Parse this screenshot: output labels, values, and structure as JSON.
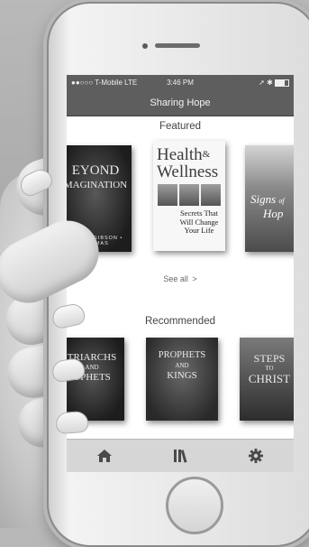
{
  "statusbar": {
    "carrier": "●●○○○ T-Mobile  LTE",
    "time": "3:46 PM",
    "icons": "➚ ✱"
  },
  "navbar": {
    "title": "Sharing Hope"
  },
  "featured": {
    "title": "Featured",
    "see_all": "See all",
    "see_all_chevron": ">",
    "books": [
      {
        "title_lines": [
          "EYOND",
          "MAGINATION"
        ],
        "authors": "NSON • GIBSON • THOMAS"
      },
      {
        "title_a": "Health",
        "amp": "&",
        "title_b": "Wellness",
        "subtitle": "Secrets That Will Change Your Life"
      },
      {
        "title_a": "Signs",
        "small": "of",
        "title_b": "Hop"
      }
    ]
  },
  "recommended": {
    "title": "Recommended",
    "books": [
      {
        "title_lines": [
          "TRIARCHS",
          "AND",
          "OPHETS"
        ]
      },
      {
        "title_lines": [
          "PROPHETS",
          "AND",
          "KINGS"
        ]
      },
      {
        "title_lines": [
          "STEPS",
          "TO",
          "CHRIST"
        ]
      }
    ]
  },
  "tabbar": {
    "items": [
      {
        "icon": "home-icon"
      },
      {
        "icon": "library-icon"
      },
      {
        "icon": "gear-icon"
      }
    ]
  },
  "colors": {
    "bar": "#5e5e5e",
    "tabbar": "#d6d6d6",
    "text": "#444444"
  }
}
